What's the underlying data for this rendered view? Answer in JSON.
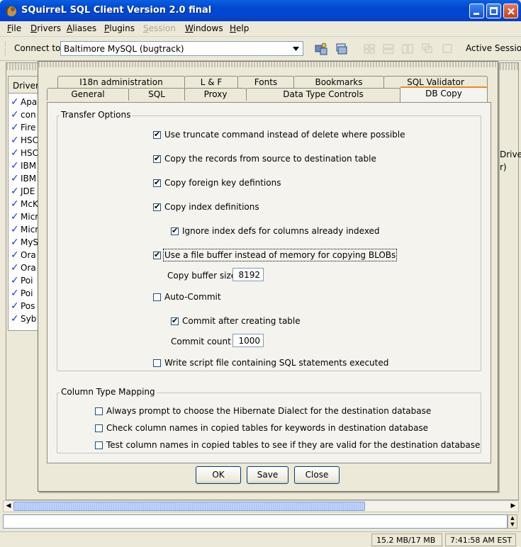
{
  "window": {
    "title": "SQuirreL SQL Client Version 2.0 final"
  },
  "menubar": {
    "items": [
      {
        "label": "File",
        "u": "F",
        "rest": "ile",
        "disabled": false
      },
      {
        "label": "Drivers",
        "u": "D",
        "rest": "rivers",
        "disabled": false
      },
      {
        "label": "Aliases",
        "u": "A",
        "rest": "liases",
        "disabled": false
      },
      {
        "label": "Plugins",
        "u": "P",
        "rest": "lugins",
        "disabled": false
      },
      {
        "label": "Session",
        "u": "S",
        "rest": "ession",
        "disabled": true
      },
      {
        "label": "Windows",
        "u": "W",
        "rest": "indows",
        "disabled": false
      },
      {
        "label": "Help",
        "u": "H",
        "rest": "elp",
        "disabled": false
      }
    ]
  },
  "toolbar": {
    "connect_label": "Connect to:",
    "alias_value": "Baltimore MySQL (bugtrack)",
    "active_session_label": "Active Sessio"
  },
  "background": {
    "drivers_header": "Drivers",
    "drivers": [
      "Apa",
      "con",
      "Fire",
      "HSC",
      "HSC",
      "IBM",
      "IBM",
      "JDE",
      "McK",
      "Micr",
      "Micr",
      "MyS",
      "Ora",
      "Ora",
      "Poi",
      "Poi",
      "Pos",
      "Syb"
    ],
    "right_text_1": "Drive",
    "right_text_2": "r)"
  },
  "statusbar": {
    "memory": "15.2 MB/17 MB",
    "time": "7:41:58 AM EST"
  },
  "dialog": {
    "tabs_row1": [
      "I18n administration",
      "L & F",
      "Fonts",
      "Bookmarks",
      "SQL Validator"
    ],
    "tabs_row2": [
      "General",
      "SQL",
      "Proxy",
      "Data Type Controls",
      "DB Copy"
    ],
    "selected_tab": "DB Copy",
    "transfer_options": {
      "title": "Transfer Options",
      "use_truncate": {
        "label": "Use truncate command instead of delete where possible",
        "checked": true
      },
      "copy_records": {
        "label": "Copy the records from source to destination table",
        "checked": true
      },
      "copy_fk": {
        "label": "Copy foreign key defintions",
        "checked": true
      },
      "copy_index": {
        "label": "Copy index definitions",
        "checked": true
      },
      "ignore_index": {
        "label": "Ignore index defs for columns already indexed",
        "checked": true
      },
      "file_buffer": {
        "label": "Use a file buffer instead of memory for copying BLOBs",
        "checked": true
      },
      "buffer_size_label": "Copy buffer size",
      "buffer_size": "8192",
      "auto_commit": {
        "label": "Auto-Commit",
        "checked": false
      },
      "commit_after_table": {
        "label": "Commit after creating table",
        "checked": true
      },
      "commit_count_label": "Commit count",
      "commit_count": "1000",
      "write_script": {
        "label": "Write script file containing SQL statements executed",
        "checked": false
      }
    },
    "column_type_mapping": {
      "title": "Column Type Mapping",
      "prompt_dialect": {
        "label": "Always prompt to choose the Hibernate Dialect for the destination database",
        "checked": false
      },
      "check_keywords": {
        "label": "Check column names in copied tables for keywords in destination database",
        "checked": false
      },
      "test_valid": {
        "label": "Test column names in copied tables to see if they are valid for the destination database",
        "checked": false
      }
    },
    "buttons": {
      "ok": "OK",
      "save": "Save",
      "close": "Close"
    }
  }
}
